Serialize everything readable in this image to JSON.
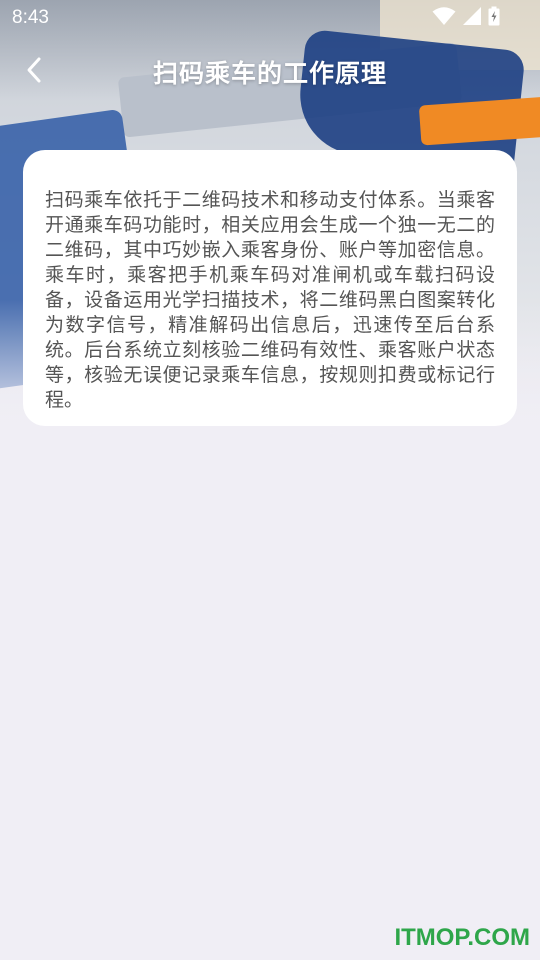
{
  "status_bar": {
    "time": "8:43",
    "icons": [
      "wifi-icon",
      "signal-icon",
      "battery-charging-icon"
    ]
  },
  "header": {
    "back_icon": "chevron-left-icon",
    "title": "扫码乘车的工作原理"
  },
  "card": {
    "text": "扫码乘车依托于二维码技术和移动支付体系。当乘客开通乘车码功能时，相关应用会生成一个独一无二的二维码，其中巧妙嵌入乘客身份、账户等加密信息。乘车时，乘客把手机乘车码对准闸机或车载扫码设备，设备运用光学扫描技术，将二维码黑白图案转化为数字信号，精准解码出信息后，迅速传至后台系统。后台系统立刻核验二维码有效性、乘客账户状态等，核验无误便记录乘车信息，按规则扣费或标记行程。"
  },
  "watermark": "ITMOP.COM",
  "colors": {
    "title": "#ffffff",
    "body_text": "#555555",
    "page_background": "#f0eef5",
    "watermark": "#2ea64a"
  }
}
